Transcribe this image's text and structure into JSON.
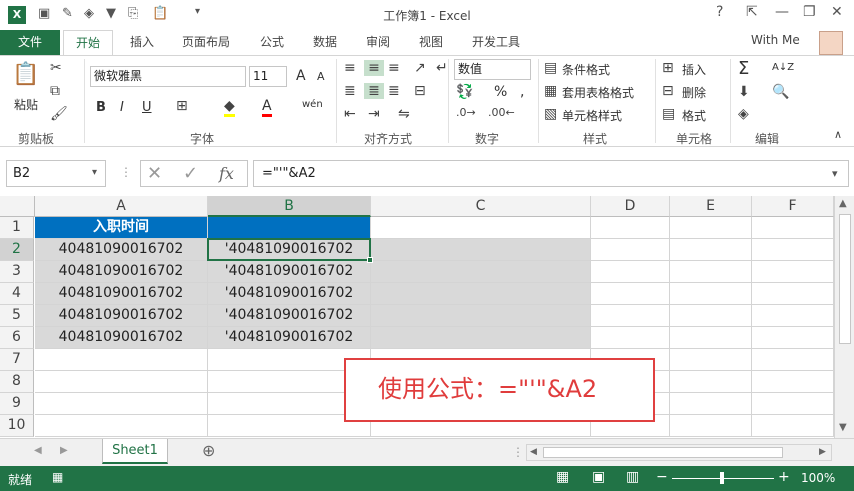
{
  "window": {
    "title": "工作簿1 - Excel",
    "help": "?",
    "minimize": "—",
    "restore": "❐",
    "close": "✕"
  },
  "tabs": {
    "file": "文件",
    "home": "开始",
    "insert": "插入",
    "page_layout": "页面布局",
    "formulas": "公式",
    "data": "数据",
    "review": "审阅",
    "view": "视图",
    "developer": "开发工具",
    "account": "With Me"
  },
  "ribbon": {
    "clipboard": {
      "paste": "粘贴",
      "label": "剪贴板"
    },
    "font": {
      "name": "微软雅黑",
      "size": "11",
      "grow": "A",
      "shrink": "A",
      "bold": "B",
      "italic": "I",
      "underline": "U",
      "font_color": "A",
      "phonetic": "wén",
      "label": "字体"
    },
    "alignment": {
      "label": "对齐方式"
    },
    "number": {
      "format": "数值",
      "percent": "%",
      "comma": ",",
      "label": "数字"
    },
    "styles": {
      "conditional": "条件格式",
      "table": "套用表格格式",
      "cell_styles": "单元格样式",
      "label": "样式"
    },
    "cells": {
      "insert": "插入",
      "delete": "删除",
      "format": "格式",
      "label": "单元格"
    },
    "editing": {
      "sum": "Σ",
      "sort": "A↓Z",
      "label": "编辑"
    }
  },
  "formula_bar": {
    "name_box": "B2",
    "formula": "=\"'\"&A2",
    "fx": "fx"
  },
  "columns": [
    "A",
    "B",
    "C",
    "D",
    "E",
    "F"
  ],
  "rows": [
    "1",
    "2",
    "3",
    "4",
    "5",
    "6",
    "7",
    "8",
    "9",
    "10"
  ],
  "cells": {
    "A1": "入职时间",
    "A2": "40481090016702",
    "A3": "40481090016702",
    "A4": "40481090016702",
    "A5": "40481090016702",
    "A6": "40481090016702",
    "B2": "'40481090016702",
    "B3": "'40481090016702",
    "B4": "'40481090016702",
    "B5": "'40481090016702",
    "B6": "'40481090016702"
  },
  "sheet_tabs": {
    "sheet1": "Sheet1",
    "add": "⊕"
  },
  "status": {
    "ready": "就绪",
    "zoom": "100%",
    "minus": "−",
    "plus": "+"
  },
  "annotation": "使用公式：=\"'\"&A2",
  "colors": {
    "excel_green": "#217346",
    "header_blue": "#0070c0",
    "fill_gray": "#d9d9d9",
    "annotation_red": "#e04040"
  }
}
